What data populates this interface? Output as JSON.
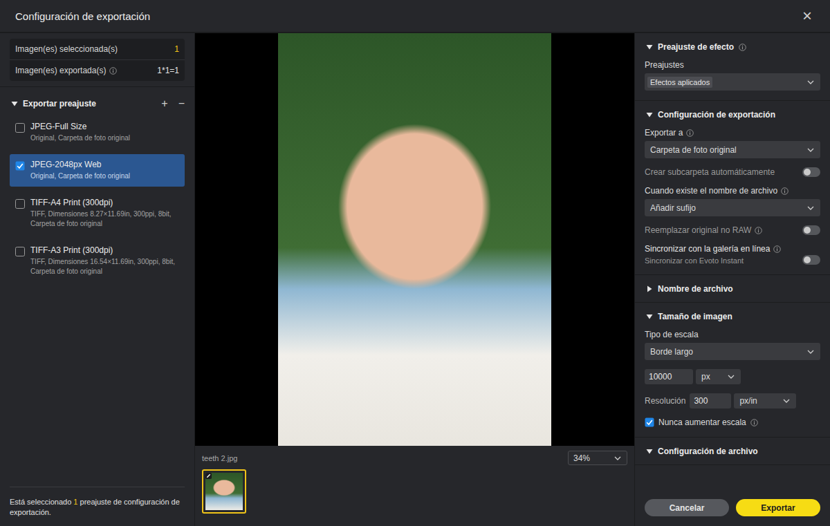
{
  "window": {
    "title": "Configuración de exportación",
    "close": "×"
  },
  "summary": [
    {
      "label": "Imagen(es) seleccionada(s)",
      "value": "1",
      "info": false,
      "highlight": true
    },
    {
      "label": "Imagen(es) exportada(s)",
      "value": "1*1=1",
      "info": true,
      "highlight": false
    }
  ],
  "presets": {
    "title": "Exportar preajuste",
    "expanded": true,
    "add": "+",
    "remove": "−",
    "items": [
      {
        "name": "JPEG-Full Size",
        "detail": "Original, Carpeta de foto original",
        "checked": false,
        "selected": false
      },
      {
        "name": "JPEG-2048px Web",
        "detail": "Original, Carpeta de foto original",
        "checked": true,
        "selected": true
      },
      {
        "name": "TIFF-A4 Print (300dpi)",
        "detail": "TIFF, Dimensiones 8.27×11.69in, 300ppi, 8bit, Carpeta de foto original",
        "checked": false,
        "selected": false
      },
      {
        "name": "TIFF-A3 Print (300dpi)",
        "detail": "TIFF, Dimensiones 16.54×11.69in, 300ppi, 8bit, Carpeta de foto original",
        "checked": false,
        "selected": false
      }
    ]
  },
  "status": {
    "before": "Está seleccionado ",
    "count": "1",
    "after": " preajuste de configuración de exportación."
  },
  "preview": {
    "filename": "teeth 2.jpg",
    "zoom": "34%",
    "thumbnails": [
      {
        "selected": true,
        "edited": true
      }
    ]
  },
  "sections": [
    {
      "title": "Preajuste de efecto",
      "expanded": true,
      "info": true,
      "rows": [
        {
          "kind": "chip",
          "label": "Preajustes",
          "value": "Efectos aplicados"
        }
      ]
    },
    {
      "title": "Configuración de exportación",
      "expanded": true,
      "info": false,
      "rows": [
        {
          "kind": "select",
          "label": "Exportar a",
          "info": true,
          "value": "Carpeta de foto original"
        },
        {
          "kind": "toggle",
          "label": "Crear subcarpeta automáticamente",
          "info": false,
          "on": false,
          "disabled": true
        },
        {
          "kind": "select",
          "label": "Cuando existe el nombre de archivo",
          "info": true,
          "value": "Añadir sufijo"
        },
        {
          "kind": "toggle",
          "label": "Reemplazar original no RAW",
          "info": true,
          "on": false,
          "disabled": true
        },
        {
          "kind": "toggle",
          "label": "Sincronizar con la galería en línea",
          "info": true,
          "on": false,
          "disabled": false,
          "sub": "Sincronizar con Evoto Instant"
        }
      ]
    },
    {
      "title": "Nombre de archivo",
      "expanded": false,
      "info": false,
      "rows": []
    },
    {
      "title": "Tamaño de imagen",
      "expanded": true,
      "info": false,
      "rows": [
        {
          "kind": "select",
          "label": "Tipo de escala",
          "info": false,
          "value": "Borde largo"
        },
        {
          "kind": "size",
          "value": "10000",
          "unit": "px"
        },
        {
          "kind": "resolution",
          "label": "Resolución",
          "value": "300",
          "unit": "px/in"
        },
        {
          "kind": "checkbox",
          "label": "Nunca aumentar escala",
          "checked": true,
          "info": true
        }
      ]
    },
    {
      "title": "Configuración de archivo",
      "expanded": true,
      "info": false,
      "rows": []
    }
  ],
  "buttons": [
    {
      "label": "Cancelar",
      "kind": "secondary"
    },
    {
      "label": "Exportar",
      "kind": "primary"
    }
  ]
}
